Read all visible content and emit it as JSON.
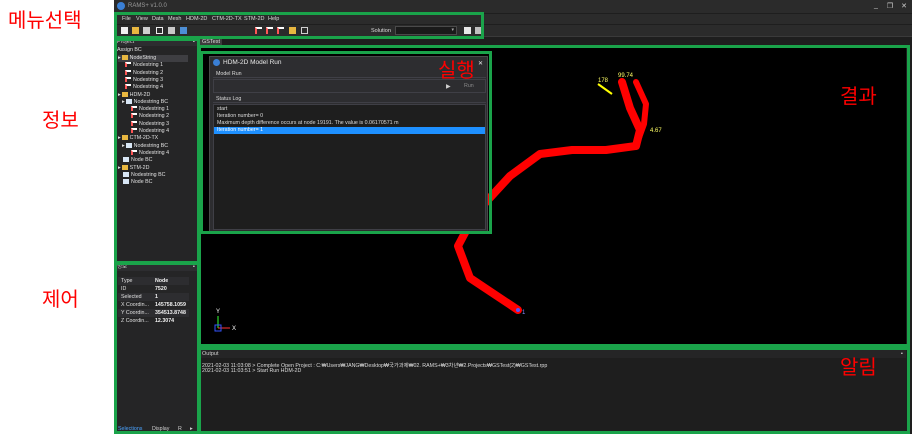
{
  "annotations": {
    "menu": "메뉴선택",
    "info": "정보",
    "control": "제어",
    "run": "실행",
    "result": "결과",
    "notify": "알림"
  },
  "window": {
    "title": "RAMS+ v1.0.0",
    "controls": [
      "_",
      "❐",
      "✕"
    ]
  },
  "menu": [
    "File",
    "View",
    "Data",
    "Mesh",
    "HDM-2D",
    "CTM-2D-TX",
    "STM-2D",
    "Help"
  ],
  "toolbar": {
    "solution_label": "Solution",
    "solution_value": ""
  },
  "project_panel": {
    "title": "Project",
    "header": "Assign BC",
    "tree": [
      {
        "label": "NodeString",
        "icon": "folder-icon",
        "expand": "▸"
      },
      {
        "label": "Nodestring 1",
        "icon": "nodestring-icon",
        "expand": ""
      },
      {
        "label": "Nodestring 2",
        "icon": "nodestring-icon",
        "expand": ""
      },
      {
        "label": "Nodestring 3",
        "icon": "nodestring-icon",
        "expand": ""
      },
      {
        "label": "Nodestring 4",
        "icon": "nodestring-icon",
        "expand": ""
      },
      {
        "label": "HDM-2D",
        "icon": "folder-icon",
        "expand": "▸"
      },
      {
        "label": "Nodestring BC",
        "icon": "box-icon",
        "expand": "▸"
      },
      {
        "label": "Nodestring 1",
        "icon": "nodestring-icon",
        "expand": ""
      },
      {
        "label": "Nodestring 2",
        "icon": "nodestring-icon",
        "expand": ""
      },
      {
        "label": "Nodestring 3",
        "icon": "nodestring-icon",
        "expand": ""
      },
      {
        "label": "Nodestring 4",
        "icon": "nodestring-icon",
        "expand": ""
      },
      {
        "label": "CTM-2D-TX",
        "icon": "folder-icon",
        "expand": "▸"
      },
      {
        "label": "Nodestring BC",
        "icon": "box-icon",
        "expand": "▸"
      },
      {
        "label": "Nodestring 4",
        "icon": "nodestring-icon",
        "expand": ""
      },
      {
        "label": "Node BC",
        "icon": "box-icon",
        "expand": ""
      },
      {
        "label": "STM-2D",
        "icon": "folder-icon",
        "expand": "▸"
      },
      {
        "label": "Nodestring BC",
        "icon": "box-icon",
        "expand": ""
      },
      {
        "label": "Node BC",
        "icon": "box-icon",
        "expand": ""
      }
    ]
  },
  "property_panel": {
    "title": "정보",
    "rows": [
      {
        "key": "Type",
        "value": "Node"
      },
      {
        "key": "ID",
        "value": "7520"
      },
      {
        "key": "Selected",
        "value": "1"
      },
      {
        "key": "X Coordin...",
        "value": "145758.1059"
      },
      {
        "key": "Y Coordin...",
        "value": "354513.8748"
      },
      {
        "key": "Z Coordin...",
        "value": "12.3074"
      }
    ],
    "tabs": [
      "Selections",
      "Display",
      "R"
    ]
  },
  "document_tab": "GSTest",
  "viewport": {
    "labels": {
      "a": "178",
      "b": "99.74",
      "c": "4.67",
      "d": "1"
    },
    "axes": {
      "y": "Y",
      "x": "X"
    }
  },
  "dialog": {
    "title": "HDM-2D Model Run",
    "section_run": "Model Run",
    "run_button": "Run",
    "section_log": "Status Log",
    "log": [
      "start",
      "Iteration number= 0",
      "Maximum depth difference occurs at node 19191. The value is 0.06170571 m",
      "Iteration number= 1"
    ],
    "selected_index": 3
  },
  "output": {
    "title": "Output",
    "lines": [
      "2021-02-03 11:03:08 > Complete Open Project : C:₩Users₩JANG₩Desktop₩국가과제₩02. RAMS+₩3차년₩2.Projects₩GSTest(2)₩GSTest.rpp",
      "2021-02-03 11:03:51 > Start Run HDM-2D"
    ]
  },
  "colors": {
    "annotation": "#ff0000",
    "box": "#1aa34a",
    "river": "#ff0000",
    "highlight": "#1e90ff"
  }
}
